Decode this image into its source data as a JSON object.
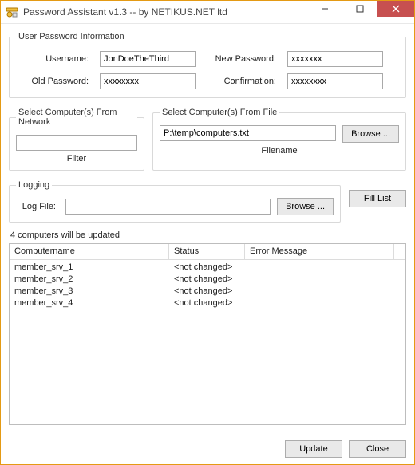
{
  "window": {
    "title": "Password Assistant v1.3 -- by NETIKUS.NET ltd"
  },
  "groups": {
    "user_info": "User  Password Information",
    "net": "Select Computer(s) From Network",
    "file": "Select Computer(s) From File",
    "logging": "Logging"
  },
  "labels": {
    "username": "Username:",
    "old_password": "Old Password:",
    "new_password": "New Password:",
    "confirmation": "Confirmation:",
    "filter": "Filter",
    "filename": "Filename",
    "log_file": "Log File:"
  },
  "values": {
    "username": "JonDoeTheThird",
    "old_password_mask": "xxxxxxxx",
    "new_password_mask": "xxxxxxx",
    "confirmation_mask": "xxxxxxxx",
    "network_filter": "",
    "file_path": "P:\\temp\\computers.txt",
    "log_file": ""
  },
  "buttons": {
    "browse": "Browse ...",
    "fill_list": "Fill List",
    "update": "Update",
    "close": "Close"
  },
  "status_text": "4 computers will be updated",
  "list": {
    "headers": {
      "computer": "Computername",
      "status": "Status",
      "error": "Error Message"
    },
    "rows": [
      {
        "computer": "member_srv_1",
        "status": "<not changed>",
        "error": ""
      },
      {
        "computer": "member_srv_2",
        "status": "<not changed>",
        "error": ""
      },
      {
        "computer": "member_srv_3",
        "status": "<not changed>",
        "error": ""
      },
      {
        "computer": "member_srv_4",
        "status": "<not changed>",
        "error": ""
      }
    ]
  }
}
